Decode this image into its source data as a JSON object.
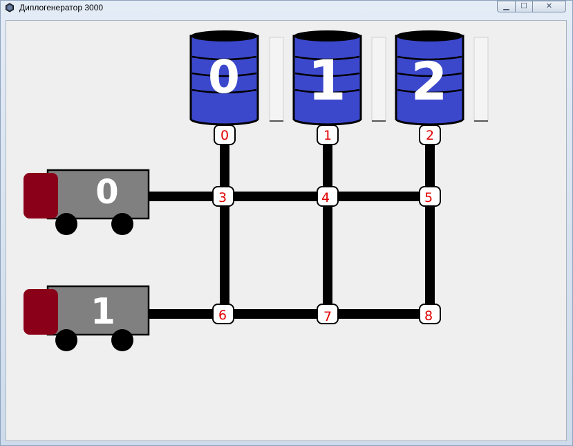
{
  "window": {
    "title": "Диплогенератор 3000",
    "controls": {
      "minimize": "▁",
      "maximize": "☐",
      "close": "✕"
    }
  },
  "colors": {
    "tank_fill": "#3c48cc",
    "truck_cab": "#8a0018",
    "truck_body": "#808080",
    "node_label": "#e00000",
    "pipe": "#000000"
  },
  "tanks": [
    {
      "label": "0"
    },
    {
      "label": "1"
    },
    {
      "label": "2"
    }
  ],
  "trucks": [
    {
      "label": "0"
    },
    {
      "label": "1"
    }
  ],
  "nodes": [
    "0",
    "1",
    "2",
    "3",
    "4",
    "5",
    "6",
    "7",
    "8"
  ]
}
